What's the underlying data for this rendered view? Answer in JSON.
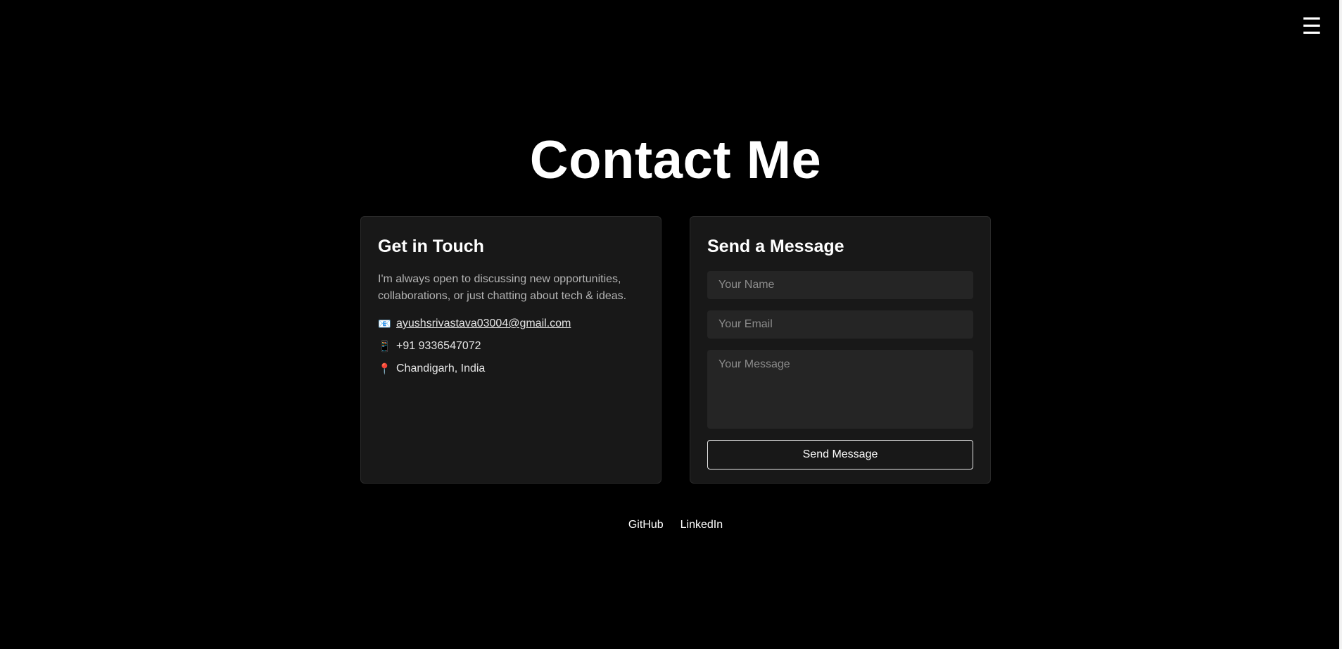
{
  "header": {
    "menu_icon": "☰"
  },
  "title": "Contact Me",
  "contact_info": {
    "heading": "Get in Touch",
    "intro": "I'm always open to discussing new opportunities, collaborations, or just chatting about tech & ideas.",
    "items": [
      {
        "icon": "📧",
        "icon_name": "email-icon",
        "text": "ayushsrivastava03004@gmail.com"
      },
      {
        "icon": "📱",
        "icon_name": "phone-icon",
        "text": "+91 9336547072"
      },
      {
        "icon": "📍",
        "icon_name": "location-pin-icon",
        "text": "Chandigarh, India"
      }
    ]
  },
  "message_form": {
    "heading": "Send a Message",
    "name_placeholder": "Your Name",
    "email_placeholder": "Your Email",
    "message_placeholder": "Your Message",
    "submit_label": "Send Message"
  },
  "footer": {
    "links": [
      "GitHub",
      "LinkedIn"
    ]
  },
  "colors": {
    "background": "#000000",
    "card": "#181818",
    "field": "#252525",
    "text": "#ffffff",
    "muted": "#b3b3b3"
  }
}
